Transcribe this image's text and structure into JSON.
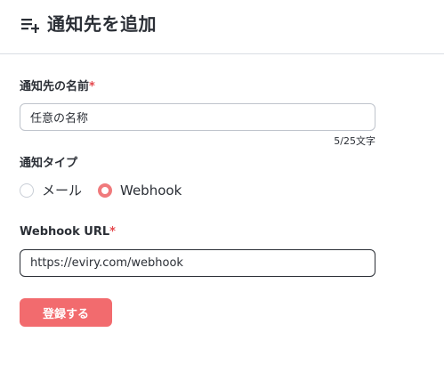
{
  "header": {
    "title": "通知先を追加",
    "icon": "playlist-add-icon"
  },
  "form": {
    "name_label": "通知先の名前",
    "required_mark": "*",
    "name_value": "任意の名称",
    "name_counter": "5/25文字",
    "type_label": "通知タイプ",
    "types": [
      {
        "label": "メール",
        "selected": false
      },
      {
        "label": "Webhook",
        "selected": true
      }
    ],
    "url_label": "Webhook URL",
    "url_value": "https://eviry.com/webhook",
    "submit_label": "登録する"
  },
  "colors": {
    "accent": "#f26b6e",
    "required": "#e5484d",
    "text": "#2b2f36",
    "border": "#bfc4cc"
  }
}
